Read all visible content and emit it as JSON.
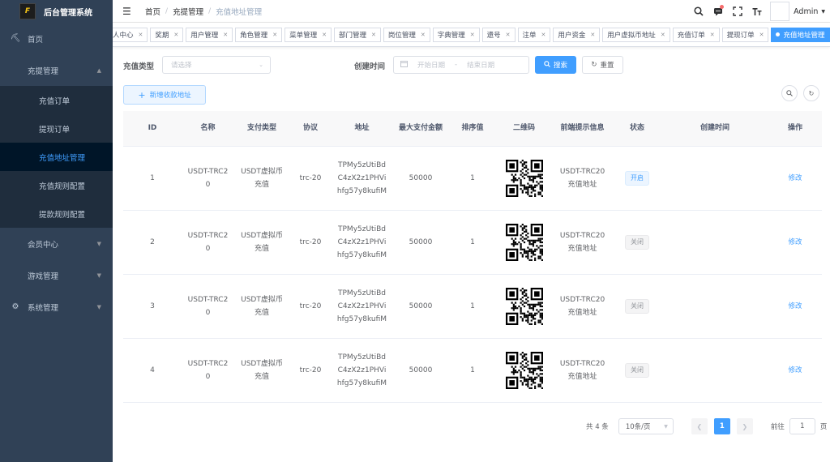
{
  "app": {
    "title": "后台管理系统",
    "logo_text": "F"
  },
  "sidebar": {
    "items": [
      {
        "label": "首页",
        "icon": "dashboard-icon"
      },
      {
        "label": "充提管理",
        "icon": "",
        "expanded": true
      },
      {
        "label": "会员中心",
        "icon": ""
      },
      {
        "label": "游戏管理",
        "icon": ""
      },
      {
        "label": "系统管理",
        "icon": "gear-icon"
      }
    ],
    "sub_items": [
      "充值订单",
      "提现订单",
      "充值地址管理",
      "充值规则配置",
      "提款规则配置"
    ],
    "active_sub": "充值地址管理"
  },
  "header": {
    "breadcrumb": [
      "首页",
      "充提管理",
      "充值地址管理"
    ],
    "user": "Admin"
  },
  "tags": [
    "人中心",
    "奖期",
    "用户管理",
    "角色管理",
    "菜单管理",
    "部门管理",
    "岗位管理",
    "字典管理",
    "遗号",
    "注单",
    "用户资金",
    "用户虚拟币地址",
    "充值订单",
    "提现订单",
    "充值地址管理"
  ],
  "filters": {
    "type_label": "充值类型",
    "type_placeholder": "请选择",
    "time_label": "创建时间",
    "start_placeholder": "开始日期",
    "range_sep": "-",
    "end_placeholder": "结束日期",
    "search_btn": "搜索",
    "reset_btn": "重置"
  },
  "add_button": "新增收款地址",
  "table": {
    "headers": [
      "ID",
      "名称",
      "支付类型",
      "协议",
      "地址",
      "最大支付金额",
      "排序值",
      "二维码",
      "前端提示信息",
      "状态",
      "创建时间",
      "操作"
    ],
    "rows": [
      {
        "id": "1",
        "name": "USDT-TRC20",
        "pay_type": "USDT虚拟币充值",
        "protocol": "trc-20",
        "address": "TPMy5zUtiBdC4zX2z1PHVihfg57y8kufiM",
        "max_amount": "50000",
        "sort": "1",
        "tip": "USDT-TRC20充值地址",
        "status": "开启",
        "status_on": true,
        "created": "",
        "action": "修改"
      },
      {
        "id": "2",
        "name": "USDT-TRC20",
        "pay_type": "USDT虚拟币充值",
        "protocol": "trc-20",
        "address": "TPMy5zUtiBdC4zX2z1PHVihfg57y8kufiM",
        "max_amount": "50000",
        "sort": "1",
        "tip": "USDT-TRC20充值地址",
        "status": "关闭",
        "status_on": false,
        "created": "",
        "action": "修改"
      },
      {
        "id": "3",
        "name": "USDT-TRC20",
        "pay_type": "USDT虚拟币充值",
        "protocol": "trc-20",
        "address": "TPMy5zUtiBdC4zX2z1PHVihfg57y8kufiM",
        "max_amount": "50000",
        "sort": "1",
        "tip": "USDT-TRC20充值地址",
        "status": "关闭",
        "status_on": false,
        "created": "",
        "action": "修改"
      },
      {
        "id": "4",
        "name": "USDT-TRC20",
        "pay_type": "USDT虚拟币充值",
        "protocol": "trc-20",
        "address": "TPMy5zUtiBdC4zX2z1PHVihfg57y8kufiM",
        "max_amount": "50000",
        "sort": "1",
        "tip": "USDT-TRC20充值地址",
        "status": "关闭",
        "status_on": false,
        "created": "",
        "action": "修改"
      }
    ]
  },
  "pagination": {
    "total": "共 4 条",
    "page_size": "10条/页",
    "current": "1",
    "goto_label": "前往",
    "goto_value": "1",
    "page_suffix": "页"
  },
  "colors": {
    "primary": "#409eff",
    "sidebar_bg": "#304156",
    "sidebar_active_text": "#409eff"
  }
}
